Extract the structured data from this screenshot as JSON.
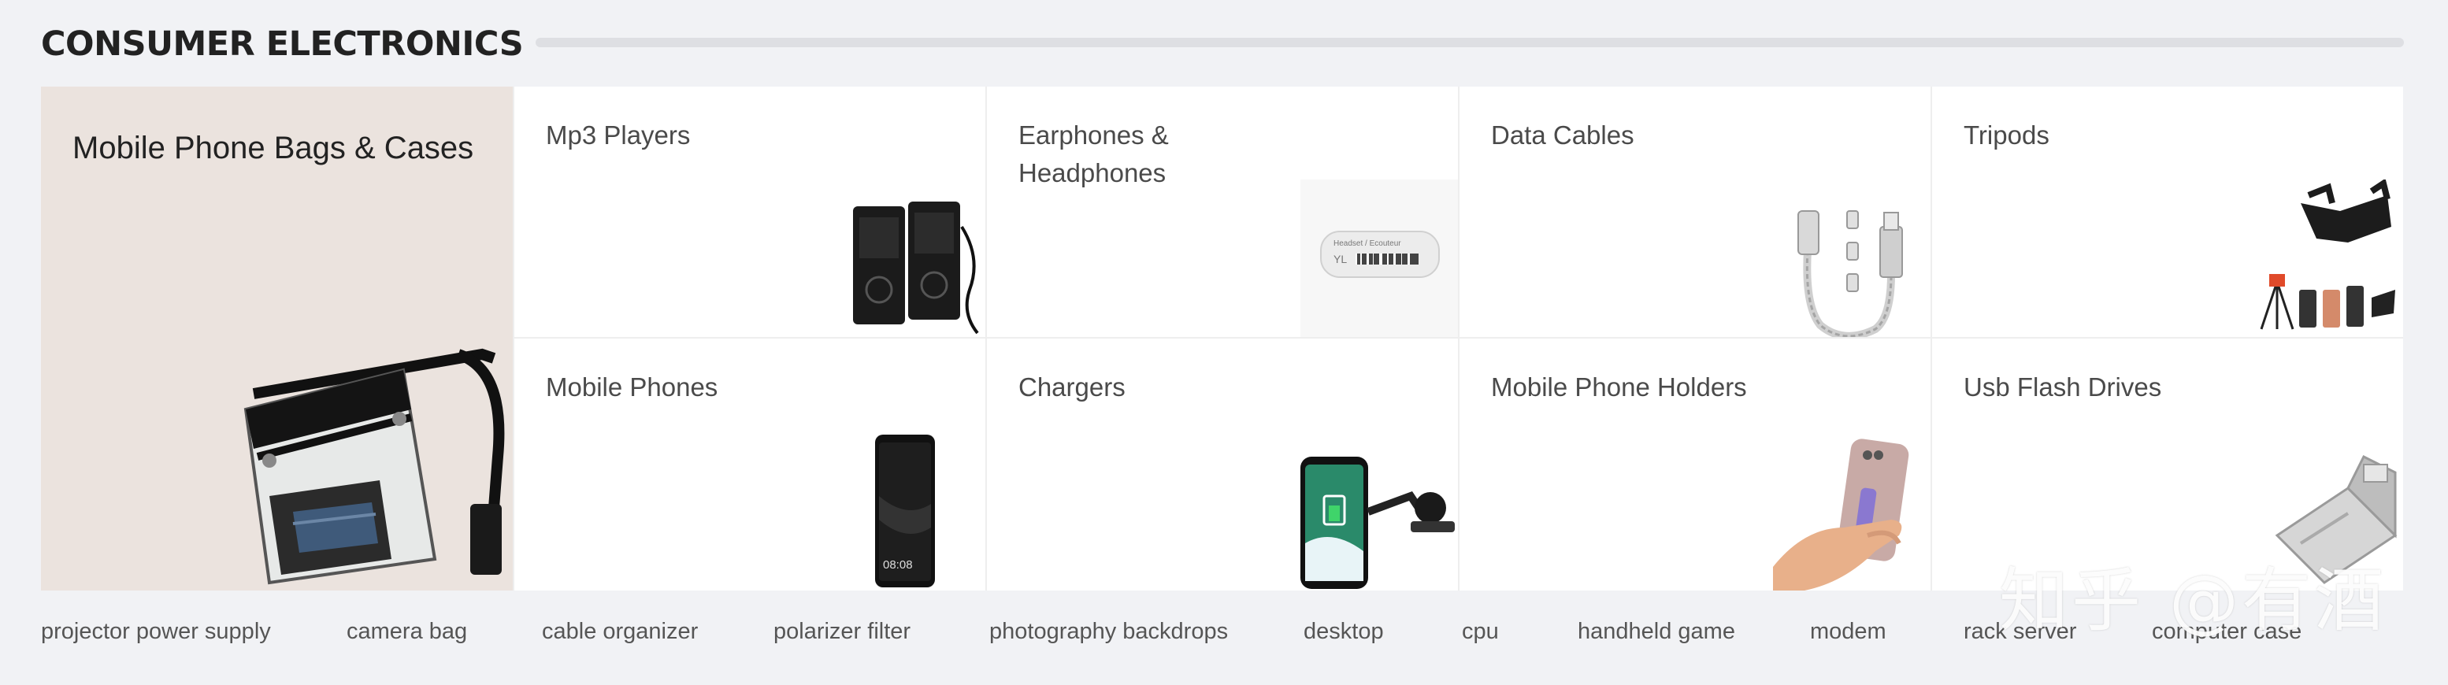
{
  "section": {
    "title": "CONSUMER ELECTRONICS"
  },
  "feature": {
    "label": "Mobile Phone Bags & Cases"
  },
  "categories": [
    {
      "label": "Mp3 Players"
    },
    {
      "label": "Earphones & Headphones"
    },
    {
      "label": "Data Cables"
    },
    {
      "label": "Tripods"
    },
    {
      "label": "Mobile Phones"
    },
    {
      "label": "Chargers"
    },
    {
      "label": "Mobile Phone Holders"
    },
    {
      "label": "Usb Flash Drives"
    }
  ],
  "product_text": {
    "phone_time": "08:08",
    "earphone_tag": "Headset / Ecouteur",
    "earphone_brand": "YL"
  },
  "tags": [
    "projector power supply",
    "camera bag",
    "cable organizer",
    "polarizer filter",
    "photography backdrops",
    "desktop",
    "cpu",
    "handheld game",
    "modem",
    "rack server",
    "computer case"
  ],
  "watermark": "知乎 @有酒",
  "colors": {
    "page_bg": "#f1f2f5",
    "feature_bg": "#ebe3de",
    "title": "#222222",
    "tag_text": "#555555"
  }
}
